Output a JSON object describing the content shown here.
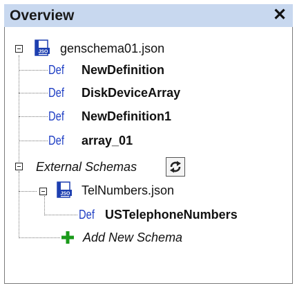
{
  "panel": {
    "title": "Overview",
    "close_glyph": "✕"
  },
  "tree": {
    "root_file": "genschema01.json",
    "def_tag": "Def",
    "definitions": [
      "NewDefinition",
      "DiskDeviceArray",
      "NewDefinition1",
      "array_01"
    ],
    "external": {
      "label": "External Schemas",
      "file": "TelNumbers.json",
      "definition": "USTelephoneNumbers",
      "add_label": "Add New Schema"
    }
  },
  "icons": {
    "json": "json-file-icon",
    "refresh": "refresh-icon",
    "add": "plus-icon",
    "collapse": "collapse-toggle-icon"
  },
  "colors": {
    "titlebar": "#c8d8ef",
    "def": "#1f3fc4",
    "plus": "#1a9a1a"
  }
}
